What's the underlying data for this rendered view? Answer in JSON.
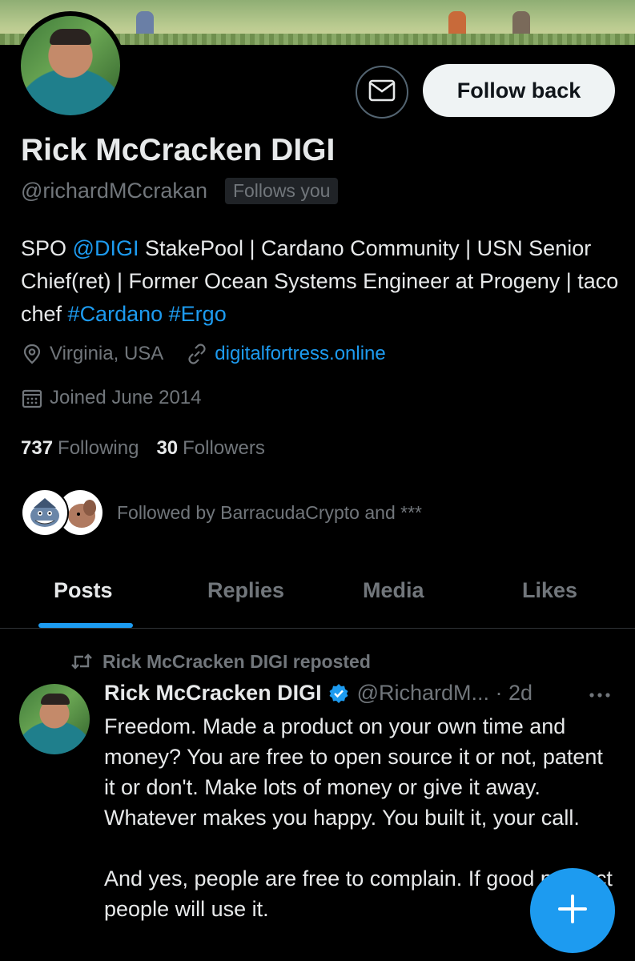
{
  "header": {
    "follow_back_label": "Follow back",
    "message_icon": "envelope-icon"
  },
  "profile": {
    "name": "Rick McCracken DIGI",
    "handle": "@richardMCcrakan",
    "follows_you": "Follows you",
    "bio": {
      "part1": "SPO ",
      "mention": "@DIGI",
      "part2": " StakePool | Cardano Community | USN Senior Chief(ret) | Former Ocean Systems Engineer at Progeny | taco chef ",
      "hashtag1": "#Cardano",
      "space": " ",
      "hashtag2": "#Ergo"
    },
    "location": "Virginia, USA",
    "website": "digitalfortress.online",
    "joined": "Joined June 2014",
    "following_count": "737",
    "following_label": "Following",
    "followers_count": "30",
    "followers_label": "Followers",
    "followed_by": "Followed by BarracudaCrypto and ***"
  },
  "tabs": {
    "posts": "Posts",
    "replies": "Replies",
    "media": "Media",
    "likes": "Likes",
    "active": "Posts"
  },
  "post": {
    "repost_label": "Rick McCracken DIGI reposted",
    "author_name": "Rick McCracken DIGI",
    "author_handle_time": "@RichardM... · 2d",
    "paragraph1": "Freedom. Made a product on your own time and money? You are free to open source it or not, patent it or don't. Make lots of money or give it away. Whatever makes you happy. You built it, your call.",
    "paragraph2": "And yes, people are free to complain. If good product people will use it."
  },
  "colors": {
    "accent": "#1d9bf0",
    "background": "#000000",
    "text": "#e7e9ea",
    "muted": "#71767b"
  }
}
